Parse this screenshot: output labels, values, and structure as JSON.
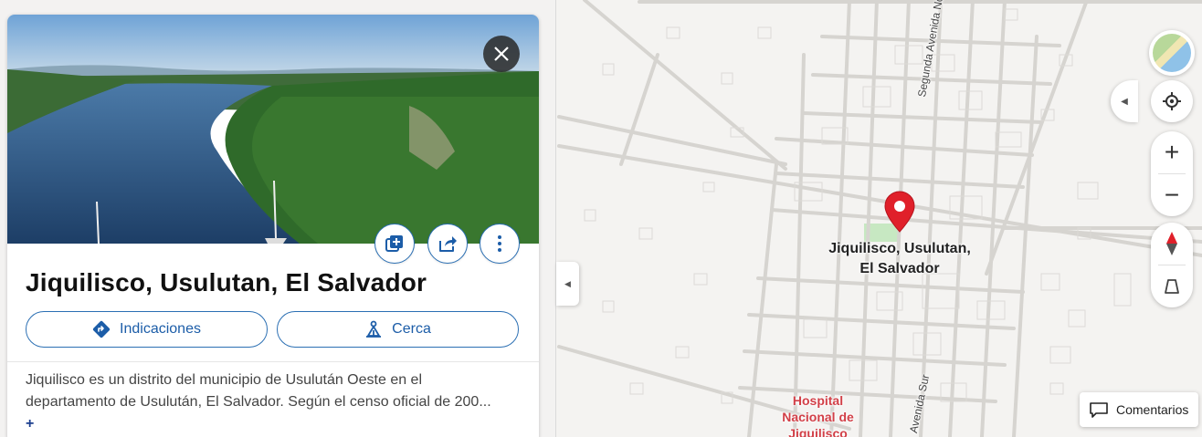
{
  "place": {
    "title": "Jiquilisco, Usulutan, El Salvador",
    "description": "Jiquilisco es un distrito del municipio de Usulután Oeste en el departamento de Usulután, El Salvador. Según el censo oficial de 200...",
    "more": "+"
  },
  "actions": {
    "directions_label": "Indicaciones",
    "nearby_label": "Cerca"
  },
  "map": {
    "city_label_line1": "Jiquilisco, Usulutan,",
    "city_label_line2": "El Salvador",
    "street_north": "Segunda Avenida Norte",
    "street_south": "Avenida Sur",
    "poi_line1": "Hospital",
    "poi_line2": "Nacional de",
    "poi_line3": "Jiquilisco",
    "pin_color": "#e0202a",
    "poi_color": "#d24048"
  },
  "controls": {
    "zoom_in": "+",
    "zoom_out": "−",
    "feedback_label": "Comentarios"
  },
  "colors": {
    "accent": "#1c5da8",
    "card_bg": "#ffffff"
  }
}
